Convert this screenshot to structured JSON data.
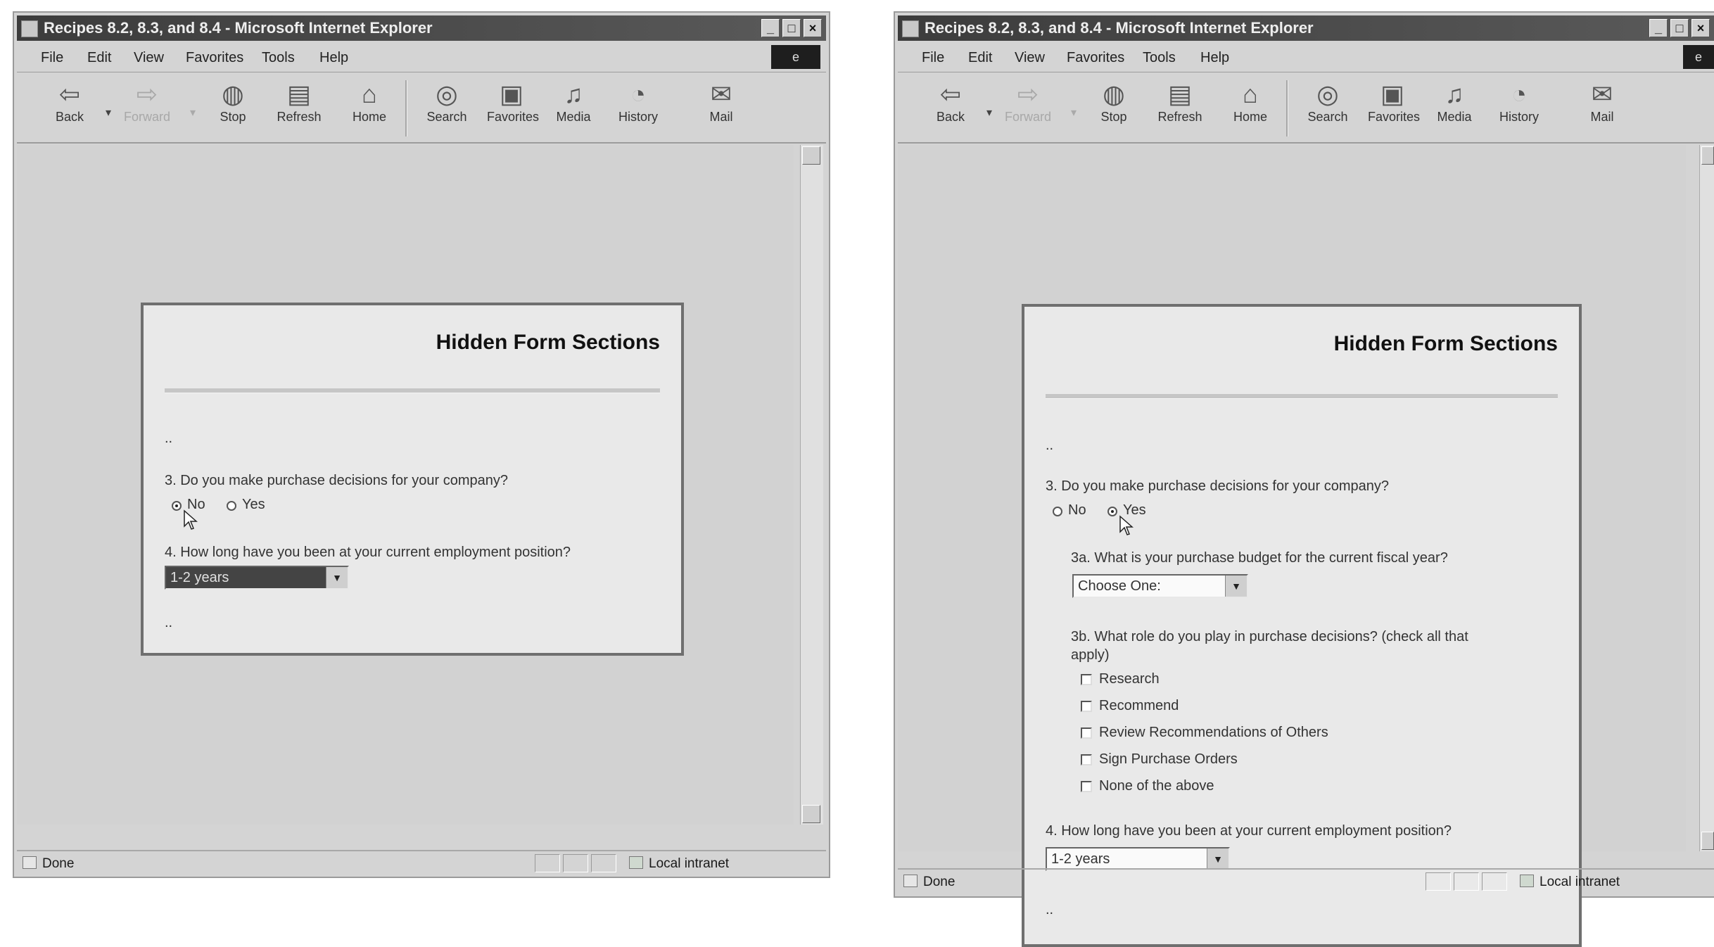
{
  "window_title": "Recipes 8.2, 8.3, and 8.4 - Microsoft Internet Explorer",
  "window_buttons": {
    "minimize": "_",
    "maximize": "□",
    "close": "×"
  },
  "menu": [
    "File",
    "Edit",
    "View",
    "Favorites",
    "Tools",
    "Help"
  ],
  "toolbar": {
    "back": "Back",
    "forward": "Forward",
    "stop": "Stop",
    "refresh": "Refresh",
    "home": "Home",
    "search": "Search",
    "favorites": "Favorites",
    "media": "Media",
    "history": "History",
    "mail": "Mail"
  },
  "icons": {
    "back": "back-arrow-icon",
    "forward": "forward-arrow-icon",
    "stop": "stop-icon",
    "refresh": "refresh-icon",
    "home": "home-icon",
    "search": "search-icon",
    "favorites": "favorites-icon",
    "media": "media-icon",
    "history": "history-icon",
    "mail": "mail-icon"
  },
  "status": {
    "done": "Done",
    "zone": "Local intranet"
  },
  "page": {
    "title": "Hidden Form Sections",
    "ellipsis": "..",
    "q3": "3. Do you make purchase decisions for your company?",
    "option_no": "No",
    "option_yes": "Yes",
    "q3a": "3a. What is your purchase budget for the current fiscal year?",
    "q3a_value": "Choose One:",
    "q3b_line1": "3b. What role do you play in purchase decisions? (check all that",
    "q3b_line2": "apply)",
    "q3b_options": [
      "Research",
      "Recommend",
      "Review Recommendations of Others",
      "Sign Purchase Orders",
      "None of the above"
    ],
    "q4": "4. How long have you been at your current employment position?",
    "q4_value": "1-2 years"
  },
  "state": {
    "left": {
      "purchase_decision": "No",
      "followups_visible": false
    },
    "right": {
      "purchase_decision": "Yes",
      "followups_visible": true
    }
  },
  "colors": {
    "titlebar": "#3c3c3c",
    "window": "#d4d4d4",
    "panel": "#e9e9e9",
    "panel_border": "#6f6f6f"
  }
}
